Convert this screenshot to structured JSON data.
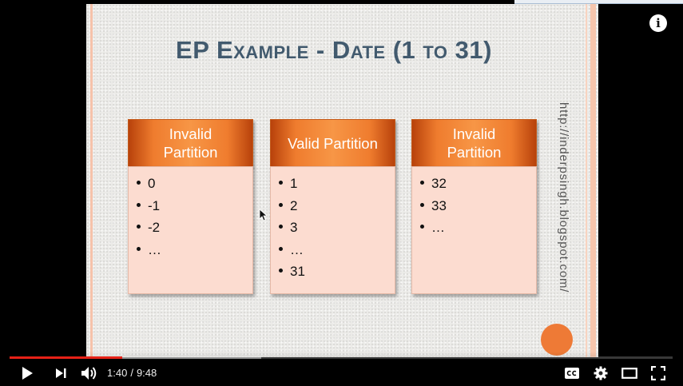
{
  "slide": {
    "title": "EP Example - Date (1 to 31)",
    "url_text": "http://inderpsingh.blogspot.com/",
    "partitions": [
      {
        "heading": "Invalid\nPartition",
        "items": [
          "0",
          "-1",
          "-2",
          "…"
        ]
      },
      {
        "heading": "Valid Partition",
        "items": [
          "1",
          "2",
          "3",
          "…",
          "31"
        ]
      },
      {
        "heading": "Invalid\nPartition",
        "items": [
          "32",
          "33",
          "…"
        ]
      }
    ]
  },
  "player": {
    "current_time": "1:40",
    "separator": "/",
    "duration": "9:48",
    "played_fraction": 0.17,
    "loaded_fraction": 0.38,
    "info_glyph": "i",
    "icons": {
      "play": "play-icon",
      "next": "next-icon",
      "volume": "volume-icon",
      "captions": "cc-icon",
      "settings": "gear-icon",
      "theater": "theater-mode-icon",
      "fullscreen": "fullscreen-icon",
      "info": "info-icon"
    },
    "colors": {
      "played": "#e62117",
      "accent": "#f79646"
    }
  }
}
